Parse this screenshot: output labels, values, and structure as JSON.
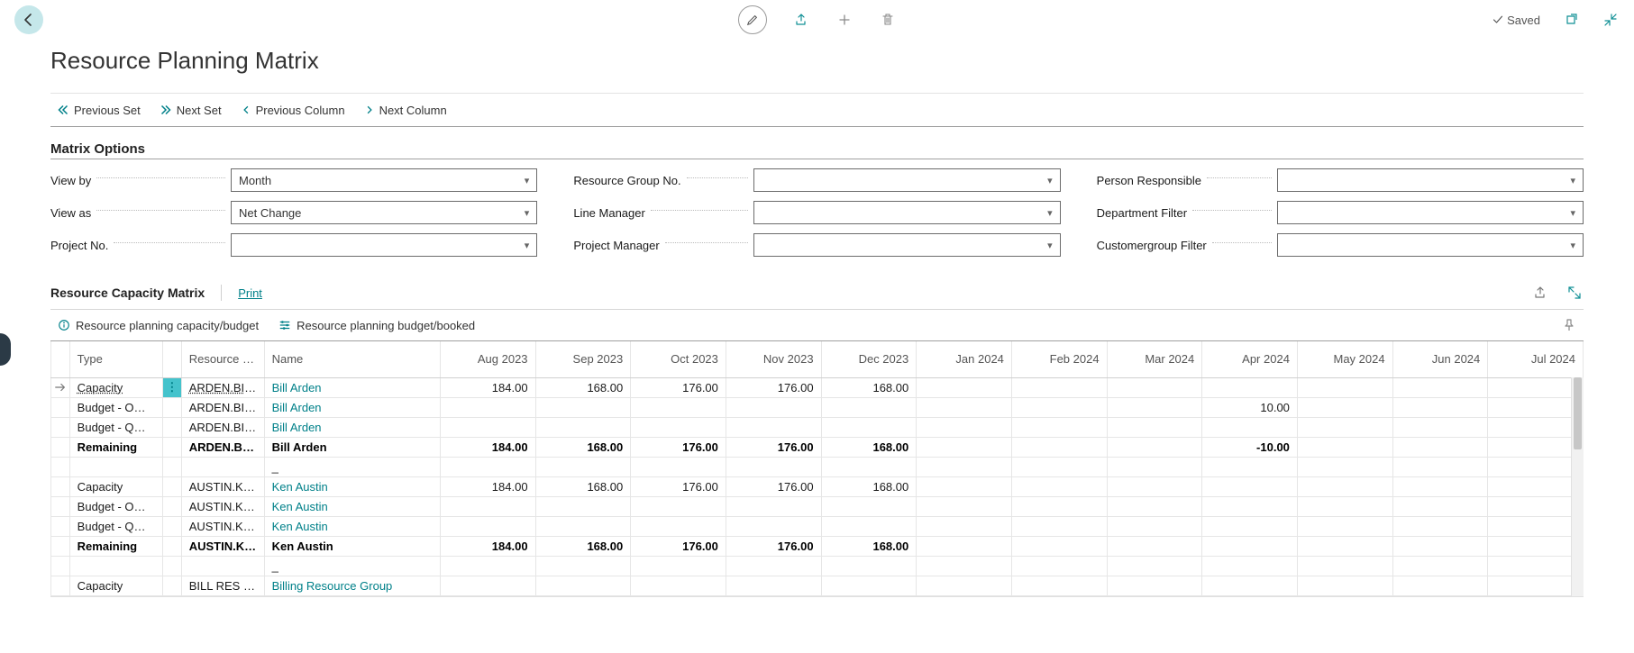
{
  "topbar": {
    "saved_label": "Saved"
  },
  "page_title": "Resource Planning Matrix",
  "nav": {
    "prev_set": "Previous Set",
    "next_set": "Next Set",
    "prev_col": "Previous Column",
    "next_col": "Next Column"
  },
  "options_heading": "Matrix Options",
  "options": {
    "view_by": {
      "label": "View by",
      "value": "Month"
    },
    "view_as": {
      "label": "View as",
      "value": "Net Change"
    },
    "project_no": {
      "label": "Project No.",
      "value": ""
    },
    "resource_group_no": {
      "label": "Resource Group No.",
      "value": ""
    },
    "line_manager": {
      "label": "Line Manager",
      "value": ""
    },
    "project_manager": {
      "label": "Project Manager",
      "value": ""
    },
    "person_responsible": {
      "label": "Person Responsible",
      "value": ""
    },
    "department_filter": {
      "label": "Department Filter",
      "value": ""
    },
    "customergroup_filter": {
      "label": "Customergroup Filter",
      "value": ""
    }
  },
  "subheader": {
    "title": "Resource Capacity Matrix",
    "print": "Print"
  },
  "subtoolbar": {
    "cap_budget": "Resource planning capacity/budget",
    "budget_booked": "Resource planning budget/booked"
  },
  "table": {
    "headers": {
      "type": "Type",
      "resource_no": "Resource No.",
      "name": "Name",
      "months": [
        "Aug 2023",
        "Sep 2023",
        "Oct 2023",
        "Nov 2023",
        "Dec 2023",
        "Jan 2024",
        "Feb 2024",
        "Mar 2024",
        "Apr 2024",
        "May 2024",
        "Jun 2024",
        "Jul 2024"
      ]
    },
    "rows": [
      {
        "selected": true,
        "type": "Capacity",
        "type_link": true,
        "res": "ARDEN.BILL",
        "res_link": true,
        "name": "Bill Arden",
        "vals": [
          "184.00",
          "168.00",
          "176.00",
          "176.00",
          "168.00",
          "",
          "",
          "",
          "",
          "",
          "",
          ""
        ]
      },
      {
        "type": "Budget - O…",
        "res": "ARDEN.BILL",
        "name": "Bill Arden",
        "vals": [
          "",
          "",
          "",
          "",
          "",
          "",
          "",
          "",
          "10.00",
          "",
          "",
          ""
        ]
      },
      {
        "type": "Budget - Q…",
        "res": "ARDEN.BILL",
        "name": "Bill Arden",
        "vals": [
          "",
          "",
          "",
          "",
          "",
          "",
          "",
          "",
          "",
          "",
          "",
          ""
        ]
      },
      {
        "bold": true,
        "type": "Remaining",
        "res": "ARDEN.BILL",
        "name": "Bill Arden",
        "vals": [
          "184.00",
          "168.00",
          "176.00",
          "176.00",
          "168.00",
          "",
          "",
          "",
          "-10.00",
          "",
          "",
          ""
        ]
      },
      {
        "type": "",
        "res": "",
        "name": "_",
        "name_plain": true,
        "vals": [
          "",
          "",
          "",
          "",
          "",
          "",
          "",
          "",
          "",
          "",
          "",
          ""
        ]
      },
      {
        "type": "Capacity",
        "res": "AUSTIN.KEN",
        "name": "Ken Austin",
        "vals": [
          "184.00",
          "168.00",
          "176.00",
          "176.00",
          "168.00",
          "",
          "",
          "",
          "",
          "",
          "",
          ""
        ]
      },
      {
        "type": "Budget - O…",
        "res": "AUSTIN.KEN",
        "name": "Ken Austin",
        "vals": [
          "",
          "",
          "",
          "",
          "",
          "",
          "",
          "",
          "",
          "",
          "",
          ""
        ]
      },
      {
        "type": "Budget - Q…",
        "res": "AUSTIN.KEN",
        "name": "Ken Austin",
        "vals": [
          "",
          "",
          "",
          "",
          "",
          "",
          "",
          "",
          "",
          "",
          "",
          ""
        ]
      },
      {
        "bold": true,
        "type": "Remaining",
        "res": "AUSTIN.KEN",
        "name": "Ken Austin",
        "vals": [
          "184.00",
          "168.00",
          "176.00",
          "176.00",
          "168.00",
          "",
          "",
          "",
          "",
          "",
          "",
          ""
        ]
      },
      {
        "type": "",
        "res": "",
        "name": "_",
        "name_plain": true,
        "vals": [
          "",
          "",
          "",
          "",
          "",
          "",
          "",
          "",
          "",
          "",
          "",
          ""
        ]
      },
      {
        "type": "Capacity",
        "res": "BILL RES GR…",
        "name": "Billing Resource Group",
        "vals": [
          "",
          "",
          "",
          "",
          "",
          "",
          "",
          "",
          "",
          "",
          "",
          ""
        ]
      }
    ]
  }
}
